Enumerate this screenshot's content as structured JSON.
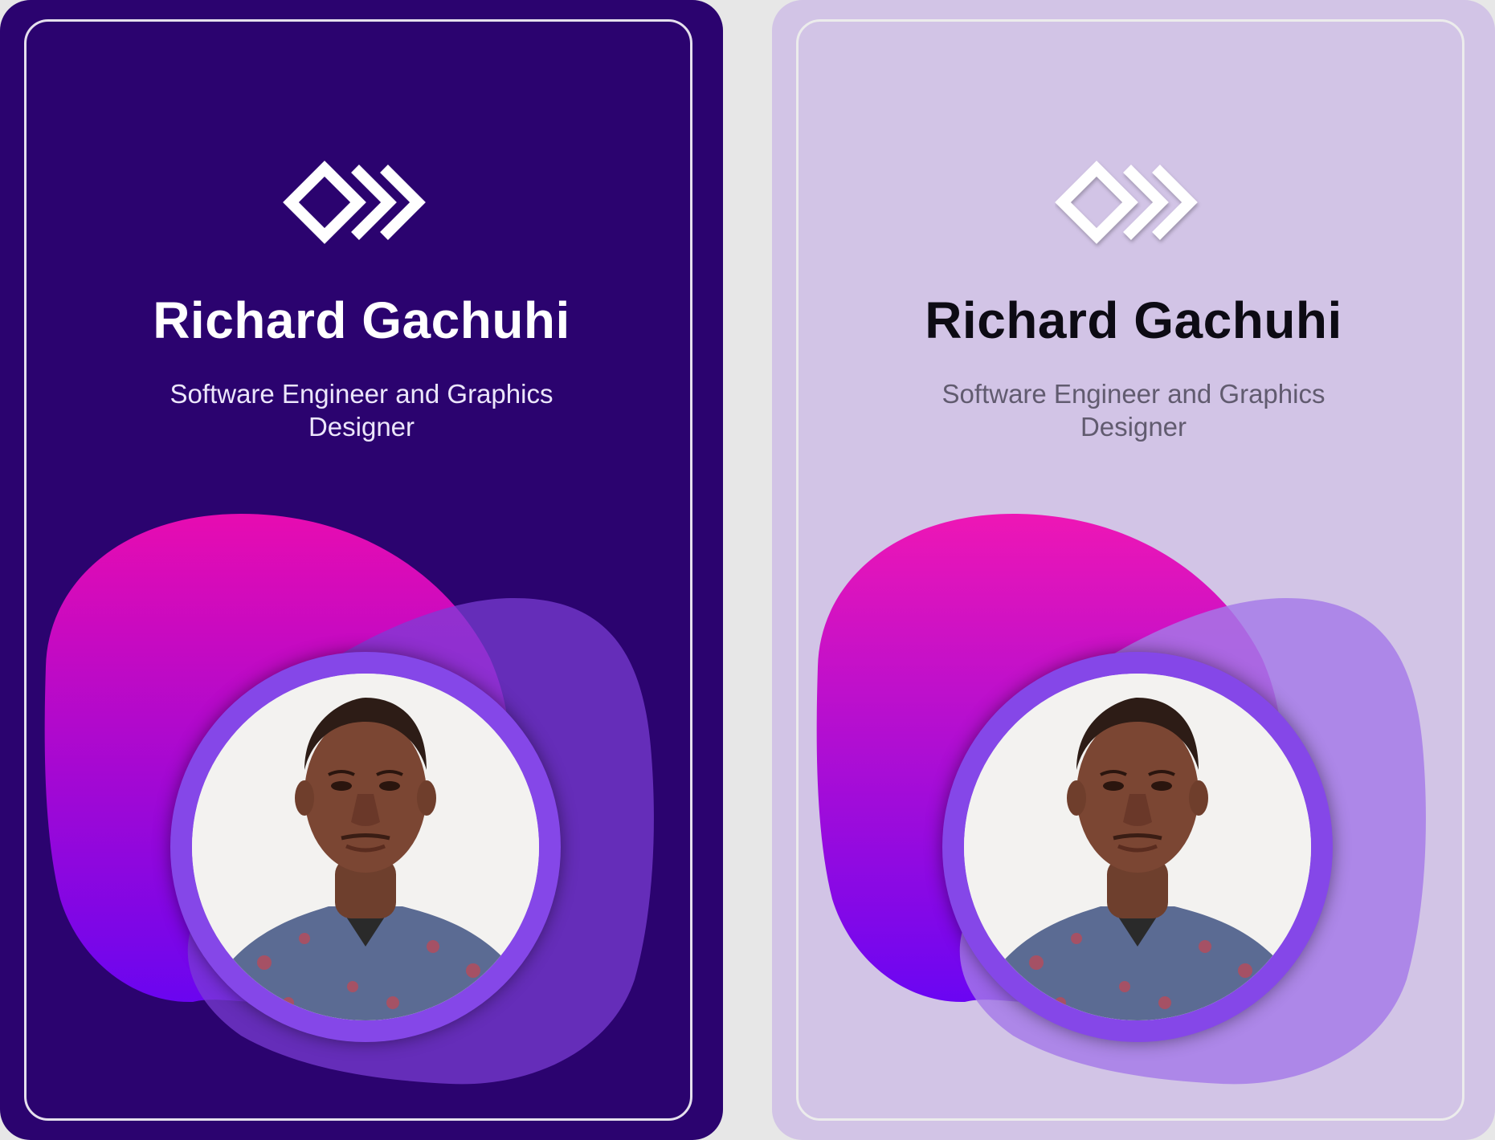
{
  "cards": [
    {
      "variant": "dark",
      "name": "Richard Gachuhi",
      "role": "Software Engineer and Graphics Designer",
      "logo_icon": "double-diamond-logo-icon",
      "avatar": "profile-photo"
    },
    {
      "variant": "light",
      "name": "Richard Gachuhi",
      "role": "Software Engineer and Graphics Designer",
      "logo_icon": "double-diamond-logo-icon",
      "avatar": "profile-photo"
    }
  ],
  "colors": {
    "dark_card_bg": "#2b036f",
    "light_card_bg": "#d2c4e6",
    "page_bg": "#e7e7e7",
    "blob_gradient_top": "#ea15b8",
    "blob_gradient_bottom": "#6a05f0",
    "dark_secondary_blob": "#5e2cb2",
    "light_secondary_blob": "#b895ec",
    "photo_ring": "#8547e8"
  }
}
